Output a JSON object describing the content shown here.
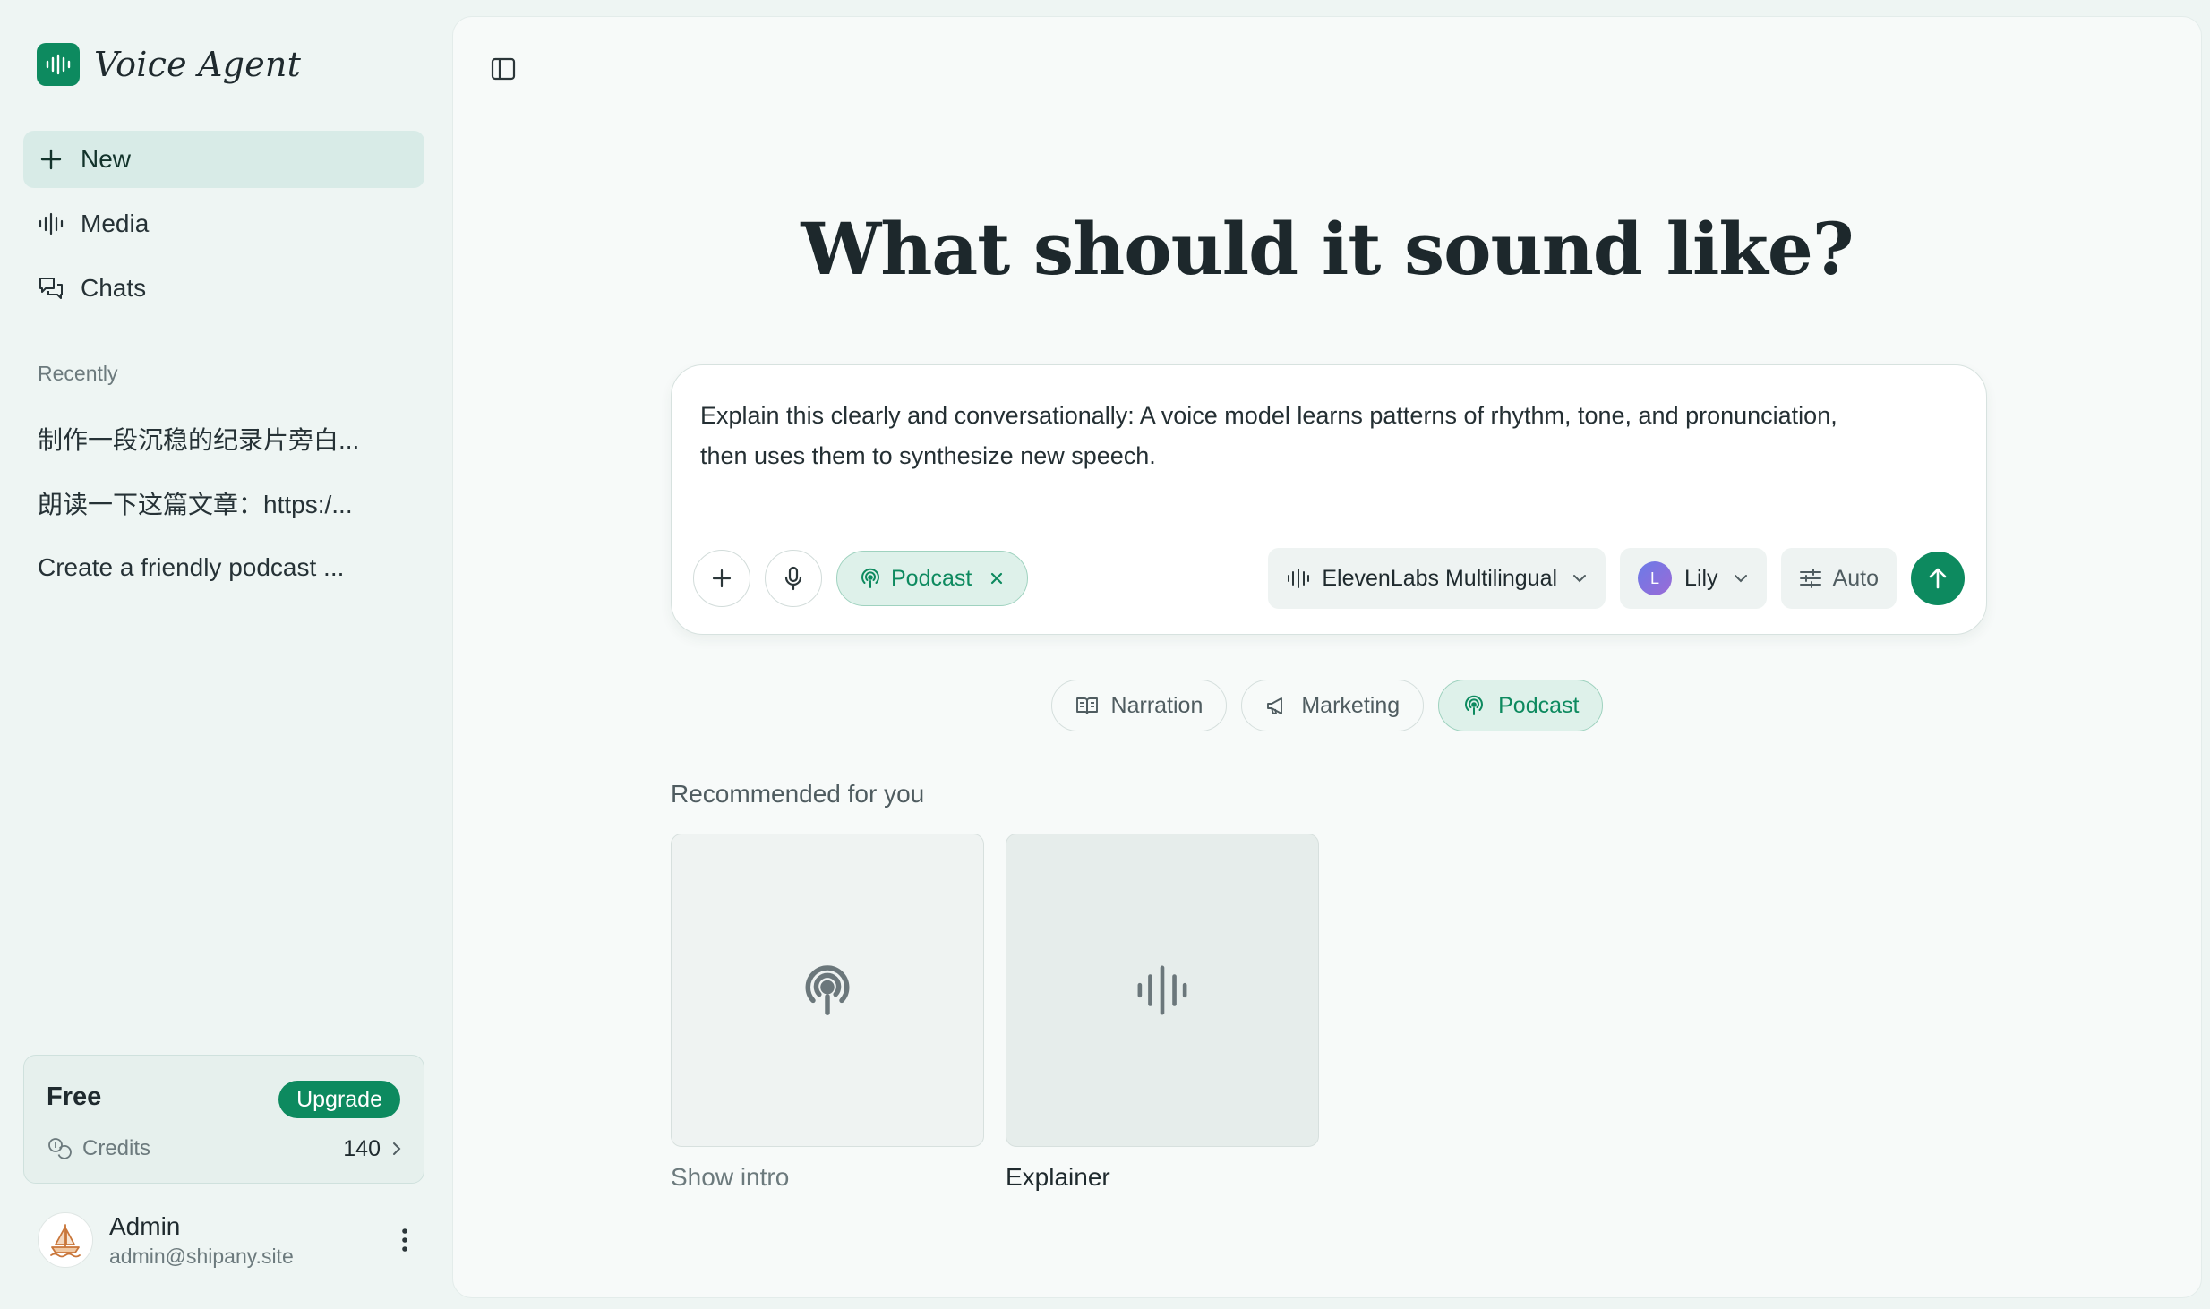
{
  "app": {
    "name": "Voice Agent",
    "brand_color": "#0d8a5f",
    "logo_icon": "audio-wave-icon"
  },
  "sidebar": {
    "nav": [
      {
        "id": "new",
        "label": "New",
        "icon": "plus-icon",
        "active": true
      },
      {
        "id": "media",
        "label": "Media",
        "icon": "audio-wave-icon",
        "active": false
      },
      {
        "id": "chats",
        "label": "Chats",
        "icon": "chat-bubbles-icon",
        "active": false
      }
    ],
    "recent_heading": "Recently",
    "recent": [
      "制作一段沉稳的纪录片旁白...",
      "朗读一下这篇文章：https:/...",
      "Create a friendly podcast ..."
    ],
    "plan": {
      "name": "Free",
      "upgrade_label": "Upgrade",
      "credits_label": "Credits",
      "credits_value": "140"
    },
    "user": {
      "name": "Admin",
      "email": "admin@shipany.site"
    }
  },
  "main": {
    "headline": "What should it sound like?",
    "composer": {
      "prompt": "Explain this clearly and conversationally: A voice model learns patterns of rhythm, tone, and pronunciation, then uses them to synthesize new speech.",
      "active_chip": "Podcast",
      "model": "ElevenLabs Multilingual",
      "voice": "Lily",
      "voice_initial": "L",
      "settings": "Auto"
    },
    "presets": [
      {
        "label": "Narration",
        "icon": "book-open-icon",
        "active": false
      },
      {
        "label": "Marketing",
        "icon": "megaphone-icon",
        "active": false
      },
      {
        "label": "Podcast",
        "icon": "podcast-icon",
        "active": true
      }
    ],
    "recommended_heading": "Recommended for you",
    "recommended": [
      {
        "label": "Show intro",
        "icon": "podcast-icon"
      },
      {
        "label": "Explainer",
        "icon": "audio-wave-icon"
      }
    ]
  }
}
